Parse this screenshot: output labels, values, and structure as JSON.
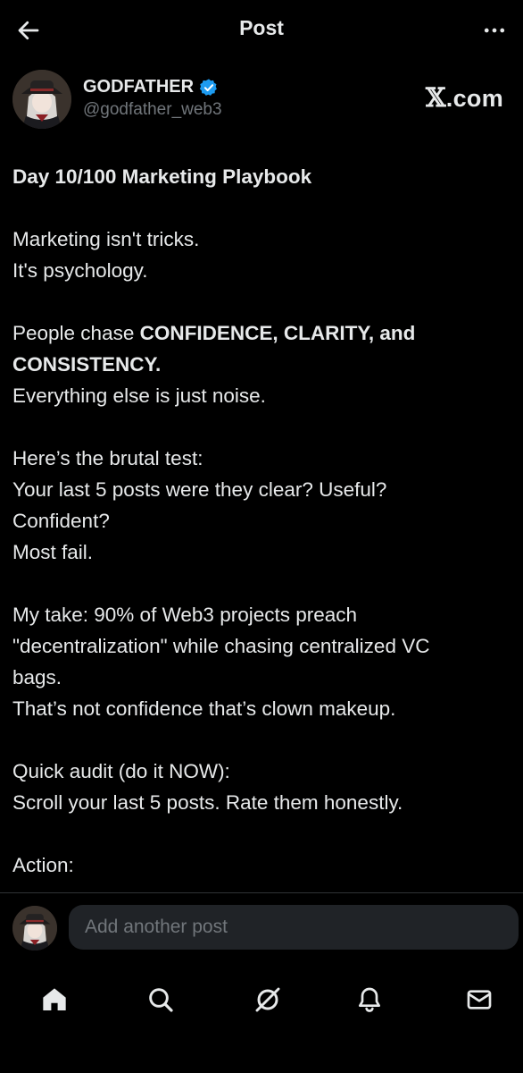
{
  "header": {
    "title": "Post",
    "back_icon": "arrow-left-icon",
    "more_icon": "more-horizontal-icon"
  },
  "author": {
    "display_name": "GODFATHER",
    "handle": "@godfather_web3",
    "verified_color": "#1d9bf0",
    "site_mark": "𝕏",
    "site_text": ".com"
  },
  "post": {
    "title": "Day 10/100 Marketing Playbook",
    "p1_line1": "Marketing isn't tricks.",
    "p1_line2": "It's psychology.",
    "p2_lead": "People chase ",
    "p2_bold1": "CONFIDENCE, CLARITY, and",
    "p2_bold2": "CONSISTENCY.",
    "p2_line3": "Everything else is just noise.",
    "p3_line1": "Here’s the brutal test:",
    "p3_line2": "Your last 5 posts were they clear? Useful?",
    "p3_line3": "Confident?",
    "p3_line4": "Most fail.",
    "p4_line1": "My take: 90% of Web3 projects preach",
    "p4_line2": "\"decentralization\" while chasing centralized VC",
    "p4_line3": "bags.",
    "p4_line4": "That’s not confidence  that’s clown makeup.",
    "p5_line1": "Quick audit (do it NOW):",
    "p5_line2": "Scroll your last 5 posts. Rate them honestly.",
    "p6_line1": "Action:"
  },
  "reply": {
    "placeholder": "Add another post"
  },
  "nav": {
    "items": [
      "home-icon",
      "search-icon",
      "grok-icon",
      "notifications-bell-icon",
      "messages-envelope-icon"
    ]
  },
  "colors": {
    "background": "#000000",
    "text": "#e7e9ea",
    "secondary": "#71767b",
    "accent": "#1d9bf0",
    "input_bg": "#202327"
  }
}
